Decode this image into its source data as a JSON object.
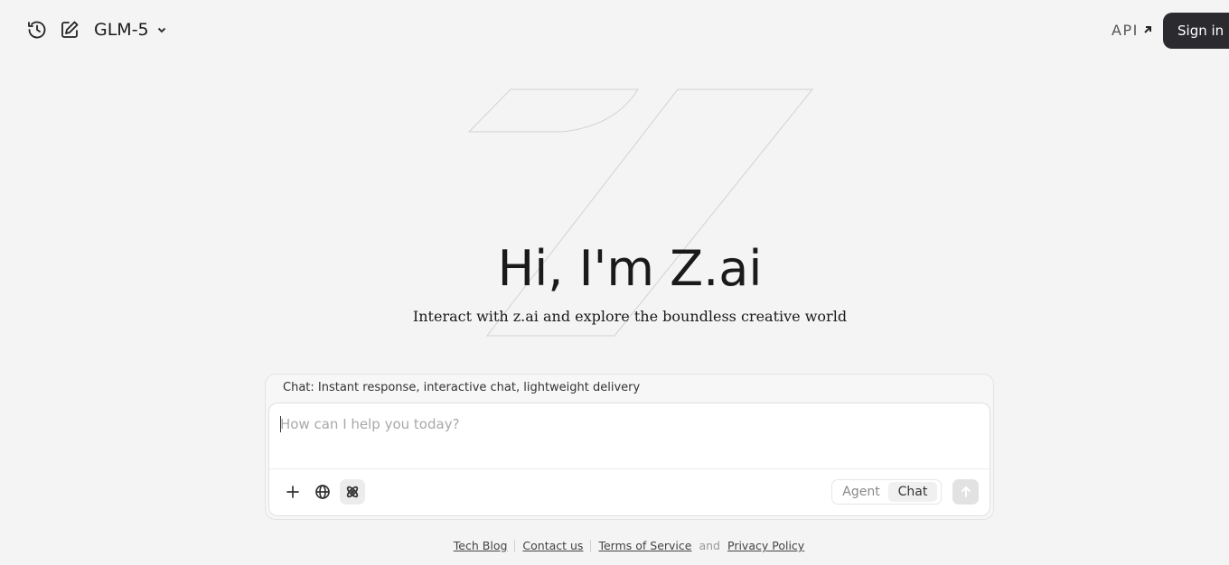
{
  "header": {
    "model_name": "GLM-5",
    "api_label": "API",
    "signin_label": "Sign in"
  },
  "hero": {
    "title": "Hi, I'm Z.ai",
    "subtitle": "Interact with z.ai and explore the boundless creative world"
  },
  "composer": {
    "mode_hint": "Chat: Instant response, interactive chat, lightweight delivery",
    "placeholder": "How can I help you today?",
    "modes": [
      "Agent",
      "Chat"
    ],
    "active_mode": "Chat"
  },
  "footer": {
    "tech_blog": "Tech Blog",
    "contact": "Contact us",
    "terms": "Terms of Service",
    "and": "and",
    "privacy": "Privacy Policy"
  },
  "icons": {
    "history": "history-icon",
    "new_chat": "edit-icon",
    "model_dropdown": "chevron-down-icon",
    "api": "arrow-up-right-icon",
    "add": "plus-icon",
    "web": "globe-icon",
    "think": "atom-icon",
    "send": "arrow-up-icon"
  }
}
